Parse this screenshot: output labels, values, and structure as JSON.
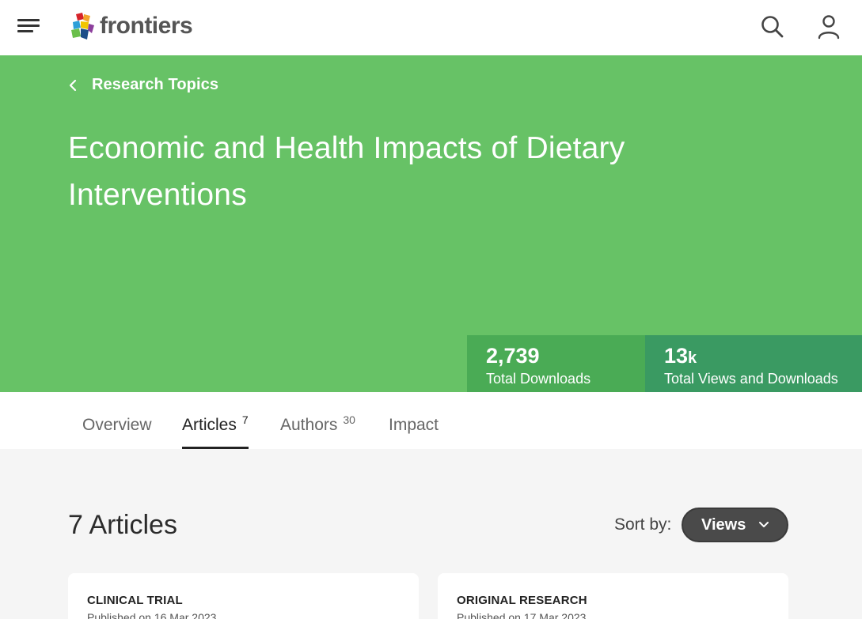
{
  "header": {
    "logo_text": "frontiers",
    "menu_icon": "hamburger-menu-icon",
    "search_icon": "search-icon",
    "account_icon": "user-icon"
  },
  "hero": {
    "background": "#67c266",
    "breadcrumb_label": "Research Topics",
    "title": "Economic and Health Impacts of Dietary Interventions",
    "stats": [
      {
        "value": "2,739",
        "suffix": "",
        "caption": "Total Downloads"
      },
      {
        "value": "13",
        "suffix": "k",
        "caption": "Total Views and Downloads"
      }
    ]
  },
  "tabs": [
    {
      "label": "Overview",
      "count": ""
    },
    {
      "label": "Articles",
      "count": "7"
    },
    {
      "label": "Authors",
      "count": "30"
    },
    {
      "label": "Impact",
      "count": ""
    }
  ],
  "articles": {
    "heading": "7 Articles",
    "sort_label": "Sort by:",
    "sort_value": "Views",
    "cards": [
      {
        "type": "CLINICAL TRIAL",
        "date": "Published on 16 Mar 2023"
      },
      {
        "type": "ORIGINAL RESEARCH",
        "date": "Published on 17 Mar 2023"
      }
    ]
  }
}
